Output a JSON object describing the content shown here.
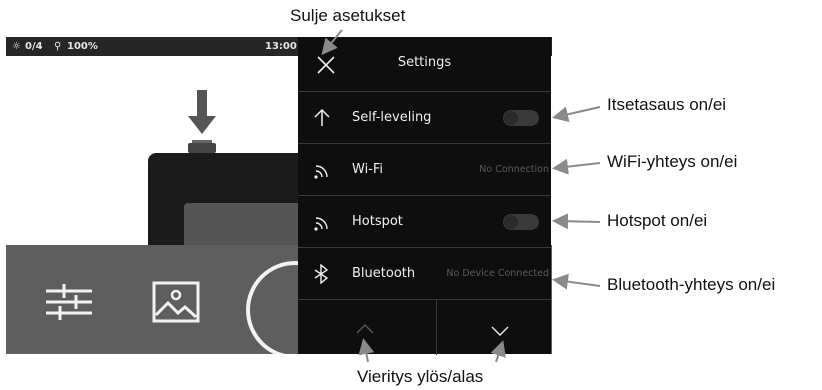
{
  "statusbar": {
    "level": "0/4",
    "battery": "100%",
    "time": "13:00"
  },
  "settings": {
    "title": "Settings",
    "rows": [
      {
        "label": "Self-leveling",
        "control": "toggle",
        "state": "off"
      },
      {
        "label": "Wi-Fi",
        "status": "No Connection"
      },
      {
        "label": "Hotspot",
        "control": "toggle",
        "state": "off"
      },
      {
        "label": "Bluetooth",
        "status": "No Device Connected"
      }
    ]
  },
  "callouts": {
    "close": "Sulje asetukset",
    "self_leveling": "Itsetasaus on/ei",
    "wifi": "WiFi-yhteys on/ei",
    "hotspot": "Hotspot on/ei",
    "bluetooth": "Bluetooth-yhteys on/ei",
    "scroll": "Vieritys ylös/alas"
  },
  "icons": {
    "close": "close-icon",
    "self_leveling": "arrow-up-icon",
    "wifi": "wifi-icon",
    "hotspot": "hotspot-icon",
    "bluetooth": "bluetooth-icon",
    "scroll_up": "chevron-up-icon",
    "scroll_down": "chevron-down-icon",
    "adjust": "sliders-icon",
    "gallery": "image-icon"
  }
}
